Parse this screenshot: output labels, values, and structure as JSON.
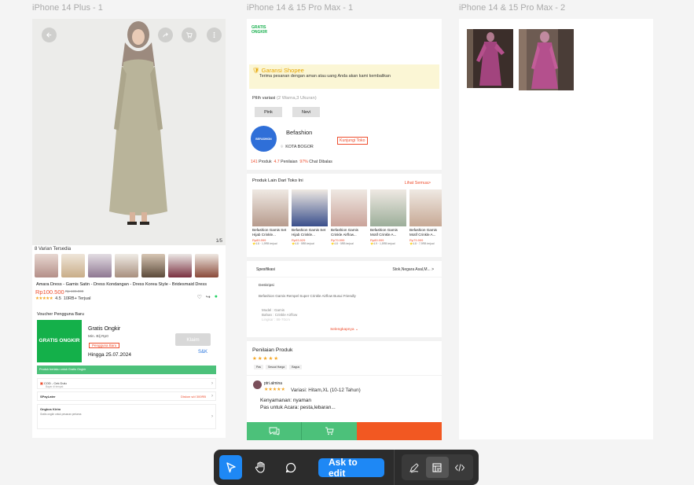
{
  "frames": {
    "f1_title": "iPhone 14 Plus - 1",
    "f2_title": "iPhone 14 & 15 Pro Max - 1",
    "f3_title": "iPhone 14 & 15 Pro Max - 2"
  },
  "frame1": {
    "pager": "1/5",
    "variants_label": "8 Varian Tersedia",
    "product_title": "Amara Dress - Gamis Satin - Dress Kondangan - Dress Korea Style - Bridesmaid Dress",
    "price": "Rp100.500",
    "price_old": "Rp 199.000",
    "rating": "4.5",
    "sold": "10RB+ Terjual",
    "voucher_section_label": "Voucher Pengguna Baru",
    "voucher_badge": "GRATIS ONGKIR",
    "voucher_title": "Gratis Ongkir",
    "voucher_min": "Min. Blj Rp0",
    "voucher_tag": "Pengguna Baru",
    "voucher_until": "Hingga 25.07.2024",
    "voucher_claim": "Klaim",
    "voucher_snk": "S&K",
    "green_bar": "Produk berlaku untuk Gratis Ongkir",
    "row_cod": "COD - Cek Dulu",
    "row_cod_sub": "Bayar di tempat",
    "row_spaylater": "SPayLater",
    "row_spaylater_right": "Diskon s/d 300RB",
    "row_ongkos": "Ongkos Kirim",
    "row_ongkos_sub": "Gratis ongkir untuk pesanan pertama"
  },
  "frame2": {
    "logo": "GRATIS ONGKIR",
    "garansi_title": "Garansi Shopee",
    "garansi_text": "Terima pesanan dengan aman atau uang Anda akan kami kembalikan",
    "pilih_label": "Pilih variasi",
    "pilih_sub": "(2 Warna,3 Ukuran)",
    "var1": "Pink",
    "var2": "Nevi",
    "shop_logo": "BEFASHION",
    "shop_name": "Befashion",
    "visit_btn": "Kunjungi Toko",
    "city": "KOTA BOGOR",
    "stat_products_n": "141",
    "stat_products_l": "Produk",
    "stat_rating_n": "4.7",
    "stat_rating_l": "Penilaian",
    "stat_chat_n": "97%",
    "stat_chat_l": "Chat Dibalas",
    "other_title": "Produk Lain Dari Toko Ini",
    "see_all": "Lihat Semua>",
    "products": [
      {
        "name": "Befashion Gamis Set Hijab Crinkle...",
        "price": "Rp89.999",
        "meta": "⭐4.8 · 1,9RB terjual",
        "color": "#b79b8d"
      },
      {
        "name": "Befashion Gamis Set Hijab Crinkle...",
        "price": "Rp93.929",
        "meta": "⭐4.8 · 5RB terjual",
        "color": "#3a4f8c"
      },
      {
        "name": "Befashion Gamis Crinkle Airflow...",
        "price": "Rp79.999",
        "meta": "⭐4.8 · 5RB terjual",
        "color": "#caa39a"
      },
      {
        "name": "Befashion Gamis Motif Crinkle A...",
        "price": "Rp89.999",
        "meta": "⭐4.9 · 1,5RB terjual",
        "color": "#9cae9a"
      },
      {
        "name": "Befashion Gamis Motif Crinkle A...",
        "price": "Rp79.999",
        "meta": "⭐4.8 · 7,9RB terjual",
        "color": "#c7a995"
      }
    ],
    "spec_title": "Spesifikasi",
    "spec_right": "Stok,Negara Asal,M...",
    "desc_label": "Deskripsi",
    "desc_text": "Befashion Gamis Rempel Super Crinkle Airflow Busui Friendly",
    "desc_model1": "Model : Gamis",
    "desc_model2": "Bahan : Crinkle Airflow",
    "desc_model3": "Lingkar : 88-70cm",
    "more_link": "Selengkapnya",
    "review_title": "Penilaian Produk",
    "chips": [
      "Pas",
      "Sesuai Harga",
      "Bagus"
    ],
    "reviewer": "ptri.almina",
    "reviewer_var": "Variasi: Hitam,XL (10-12 Tahun)",
    "rev_line1": "Kenyamanan: nyaman",
    "rev_line2": "Pas untuk Acara: pesta,lebaran..."
  },
  "toolbar": {
    "ask": "Ask to edit"
  }
}
